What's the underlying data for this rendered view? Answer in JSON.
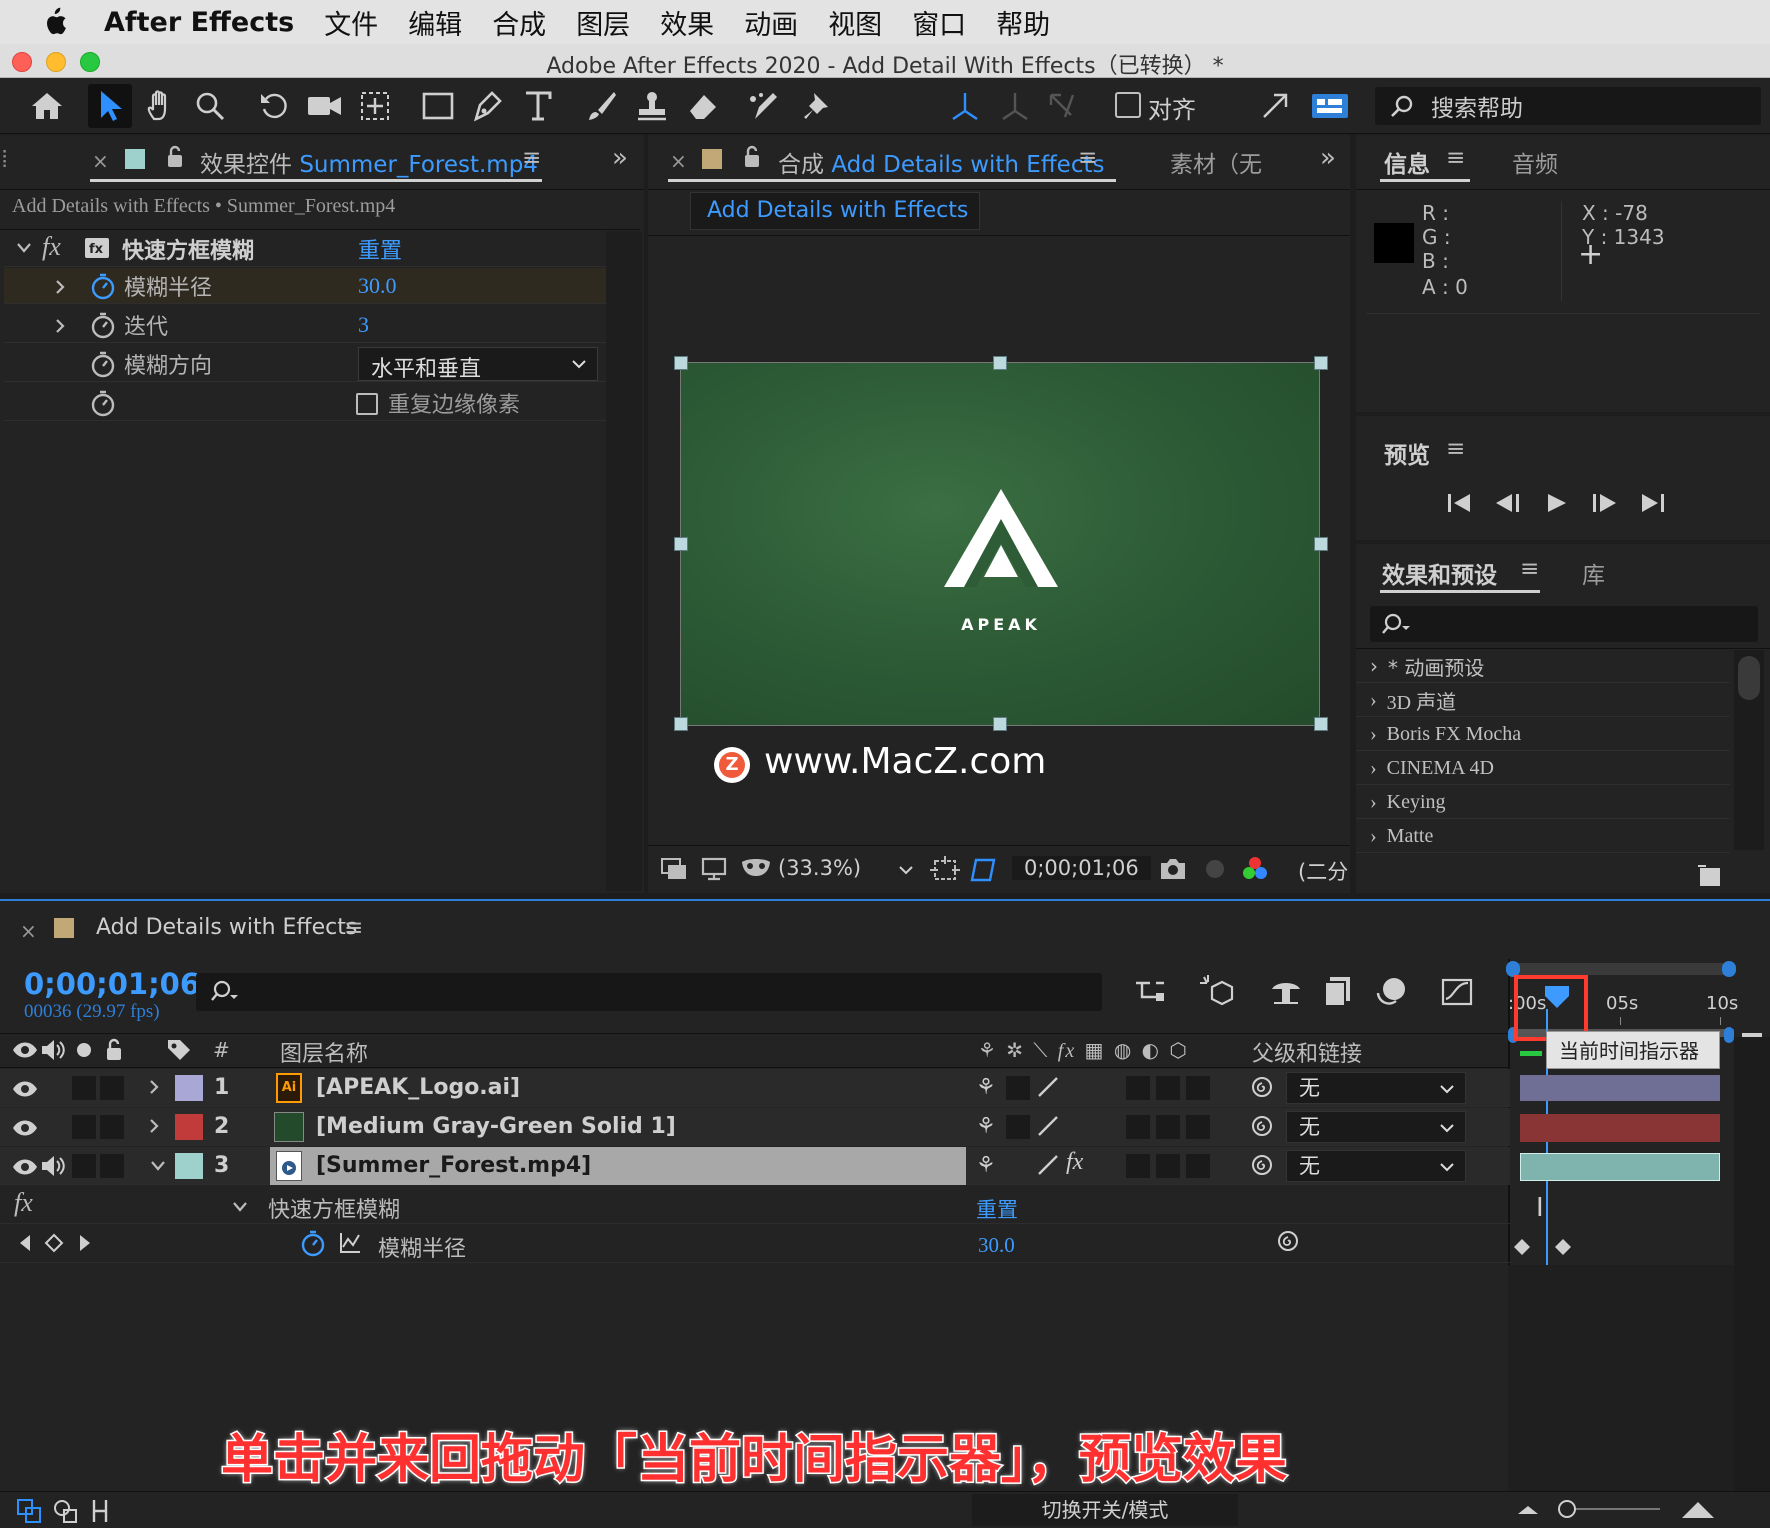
{
  "menubar": {
    "app_name": "After Effects",
    "items": [
      "文件",
      "编辑",
      "合成",
      "图层",
      "效果",
      "动画",
      "视图",
      "窗口",
      "帮助"
    ]
  },
  "window": {
    "title": "Adobe After Effects 2020 - Add Detail With Effects（已转换） *"
  },
  "toolbar": {
    "align_label": "对齐",
    "search_help": "搜索帮助"
  },
  "effect_controls": {
    "tab_prefix": "效果控件",
    "tab_file": "Summer_Forest.mp4",
    "breadcrumb": "Add Details with Effects • Summer_Forest.mp4",
    "effect_name": "快速方框模糊",
    "reset": "重置",
    "props": [
      {
        "name": "模糊半径",
        "value": "30.0"
      },
      {
        "name": "迭代",
        "value": "3"
      },
      {
        "name": "模糊方向",
        "value": "水平和垂直"
      }
    ],
    "checkbox_label": "重复边缘像素"
  },
  "composition": {
    "tab_prefix": "合成",
    "tab_name": "Add Details with Effects",
    "footage_tab": "素材（无",
    "comp_button": "Add Details with Effects",
    "logo_text": "APEAK",
    "watermark": "www.MacZ.com",
    "zoom": "(33.3%)",
    "timecode": "0;00;01;06",
    "resolution": "(二分"
  },
  "info_panel": {
    "tab_info": "信息",
    "tab_audio": "音频",
    "r": "R :",
    "g": "G :",
    "b": "B :",
    "a": "A :  0",
    "x": "X : -78",
    "y": "Y :  1343"
  },
  "preview_panel": {
    "title": "预览"
  },
  "effects_presets": {
    "tab": "效果和预设",
    "tab_library": "库",
    "items": [
      "* 动画预设",
      "3D 声道",
      "Boris FX Mocha",
      "CINEMA 4D",
      "Keying",
      "Matte"
    ]
  },
  "timeline": {
    "comp_name": "Add Details with Effects",
    "timecode": "0;00;01;06",
    "frames": "00036 (29.97 fps)",
    "ruler": {
      "start": ":00s",
      "mid": "05s",
      "end": "10s"
    },
    "col_hash": "#",
    "col_layer_name": "图层名称",
    "col_parent": "父级和链接",
    "tooltip": "当前时间指示器",
    "layers": [
      {
        "num": "1",
        "name": "[APEAK_Logo.ai]",
        "label_color": "#a9a7d6",
        "bar_color": "#7c7ca8",
        "parent": "无"
      },
      {
        "num": "2",
        "name": "[Medium Gray-Green Solid 1]",
        "label_color": "#c23b3b",
        "bar_color": "#8a3535",
        "parent": "无"
      },
      {
        "num": "3",
        "name": "[Summer_Forest.mp4]",
        "label_color": "#9fd1cc",
        "bar_color": "#7fb3ad",
        "parent": "无"
      }
    ],
    "effect_row": {
      "name": "快速方框模糊",
      "reset": "重置"
    },
    "prop_row": {
      "name": "模糊半径",
      "value": "30.0"
    },
    "bottom_label": "切换开关/模式"
  },
  "caption": "单击并来回拖动「当前时间指示器」，预览效果",
  "colors": {
    "accent_blue": "#3d9bff",
    "highlight_red": "#ff3b30",
    "caption_red": "#ff3030"
  }
}
